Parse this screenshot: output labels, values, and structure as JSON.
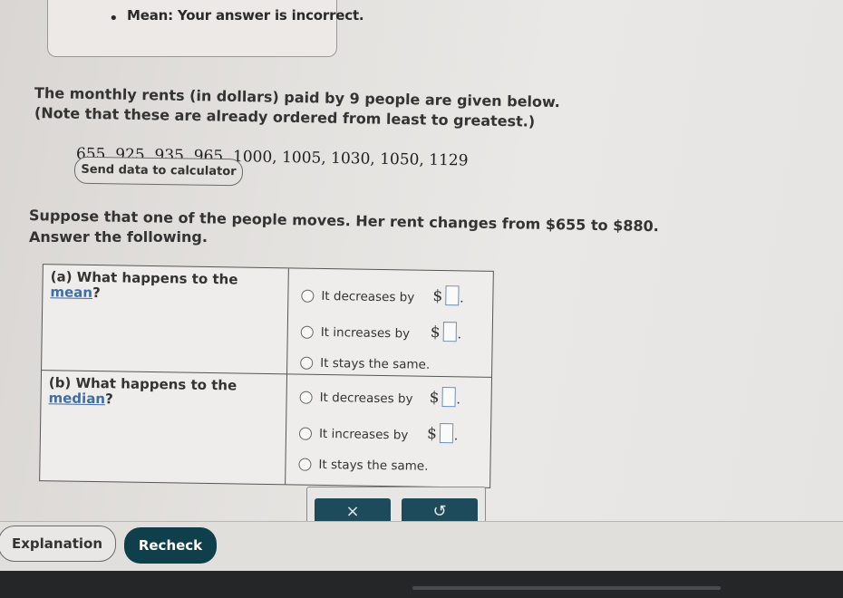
{
  "feedback": {
    "bullet": "•",
    "text": "Mean: Your answer is incorrect."
  },
  "problem": {
    "line1": "The monthly rents (in dollars) paid by 9 people are given below.",
    "line2": "(Note that these are already ordered from least to greatest.)",
    "data": "655, 925, 935, 965, 1000, 1005, 1030, 1050, 1129",
    "send_button": "Send data to calculator",
    "line3": "Suppose that one of the people moves. Her rent changes from $655 to $880.",
    "line4": "Answer the following."
  },
  "table": {
    "part_a": {
      "prefix": "(a)  What happens to the",
      "link": "mean",
      "suffix": "?"
    },
    "part_b": {
      "prefix": "(b)  What happens to the",
      "link": "median",
      "suffix": "?"
    },
    "options": {
      "decreases": "It decreases by",
      "increases": "It increases by",
      "same": "It stays the same."
    },
    "currency": "$",
    "period": "."
  },
  "tools": {
    "clear_icon": "×",
    "undo_icon": "↺"
  },
  "buttons": {
    "explanation": "Explanation",
    "recheck": "Recheck"
  }
}
